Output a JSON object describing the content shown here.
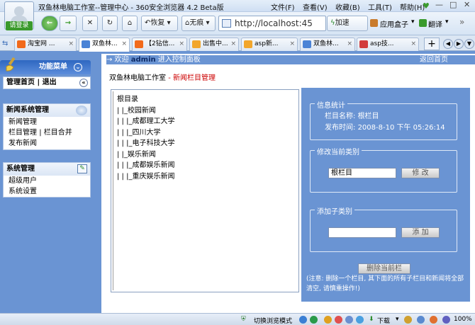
{
  "window": {
    "title": "双鱼林电脑工作室--管理中心 - 360安全浏览器 4.2 Beta版",
    "login_button": "请登录"
  },
  "menubar": [
    "文件(F)",
    "查看(V)",
    "收藏(B)",
    "工具(T)",
    "帮助(H)"
  ],
  "toolbar": {
    "restore": "恢复",
    "incognito": "无痕",
    "address": "http://localhost:45",
    "accelerate": "加速",
    "app_box": "应用盒子",
    "translate": "翻译"
  },
  "tabs": [
    {
      "label": "淘宝网 ...",
      "color": "#f26a1b"
    },
    {
      "label": "双鱼林...",
      "color": "#4a83d6",
      "active": true
    },
    {
      "label": "【2钻信...",
      "color": "#f26a1b"
    },
    {
      "label": "出售中...",
      "color": "#f2a62b"
    },
    {
      "label": "asp新...",
      "color": "#f2a62b"
    },
    {
      "label": "双鱼林...",
      "color": "#4a83d6"
    },
    {
      "label": "asp技...",
      "color": "#d23c3c"
    }
  ],
  "sidebar": {
    "menu_title": "功能菜单",
    "home": "管理首页",
    "divider": "|",
    "logout": "退出",
    "news_section": {
      "title": "新闻系统管理",
      "items": [
        "新闻管理",
        "栏目管理",
        "栏目合并",
        "发布新闻"
      ]
    },
    "sys_section": {
      "title": "系统管理",
      "items": [
        "超级用户",
        "系统设置"
      ]
    }
  },
  "header": {
    "welcome_prefix": "→ 欢迎",
    "user": "admin",
    "welcome_suffix": "进入控制面板",
    "back_home": "返回首页"
  },
  "breadcrumb": {
    "site": "双鱼林电脑工作室",
    "sep": "-",
    "page": "新闻栏目管理"
  },
  "tree": [
    "根目录",
    "| |_校园新闻",
    "| | |_成都理工大学",
    "| | |_四川大学",
    "| | |_电子科技大学",
    "| |_娱乐新闻",
    "| | |_成都娱乐新闻",
    "| | |_重庆娱乐新闻"
  ],
  "info": {
    "legend": "信息统计",
    "name_label": "栏目名称:",
    "name_value": "根栏目",
    "time_label": "发布时间:",
    "time_value": "2008-8-10 下午 05:26:14"
  },
  "edit": {
    "legend": "修改当前类别",
    "value": "根栏目",
    "button": "修 改"
  },
  "add": {
    "legend": "添加子类别",
    "value": "",
    "button": "添 加"
  },
  "delete_button": "删除当前栏",
  "note": "(注意: 删除一个栏目, 其下面的所有子栏目和新闻将全部清空, 请慎重操作!)",
  "status": {
    "mode": "切换浏览模式",
    "download": "下载",
    "zoom": "100%"
  }
}
